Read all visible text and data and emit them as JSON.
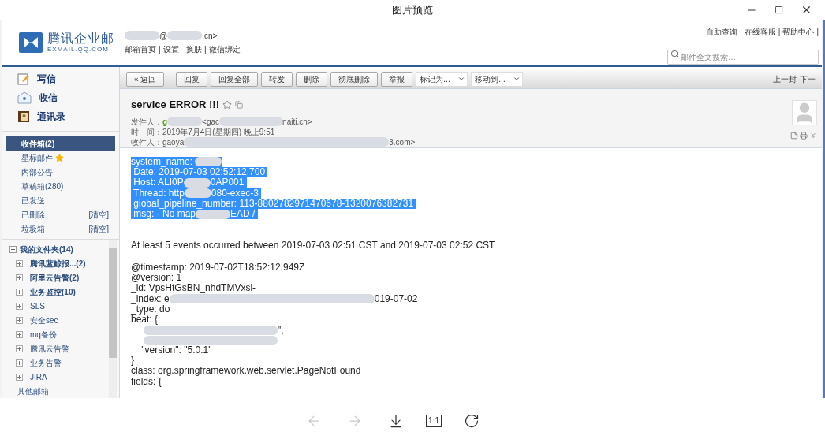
{
  "window": {
    "title": "图片预览"
  },
  "mail": {
    "logo": {
      "name": "腾讯企业邮",
      "domain": "EXMAIL.QQ.COM"
    },
    "account": [
      {
        "kind": "blot"
      },
      {
        "kind": "text",
        "text": "@"
      },
      {
        "kind": "blot"
      },
      {
        "kind": "text",
        "text": ".cn>"
      }
    ],
    "top_links": [
      {
        "label": "邮箱首页",
        "sep": "|"
      },
      {
        "label": "设置",
        "sep": "-"
      },
      {
        "label": "换肤",
        "sep": "|"
      },
      {
        "label": "微信绑定"
      }
    ],
    "help_links": [
      {
        "label": "自助查询",
        "sep": "|"
      },
      {
        "label": "在线客服",
        "sep": "|"
      },
      {
        "label": "帮助中心",
        "sep": "|"
      }
    ],
    "search": {
      "placeholder": "邮件全文搜索…"
    },
    "actions": [
      {
        "kind": "compose",
        "label": "写信"
      },
      {
        "kind": "receive",
        "label": "收信"
      },
      {
        "kind": "contacts",
        "label": "通讯录"
      }
    ],
    "folders": [
      {
        "label": "收件箱(2)",
        "selected": true
      },
      {
        "label": "星标邮件",
        "selected": false,
        "starred": true
      },
      {
        "label": "内部公告",
        "selected": false
      },
      {
        "label": "草稿箱(280)",
        "selected": false
      },
      {
        "label": "已发送",
        "selected": false
      },
      {
        "label": "已删除",
        "selected": false,
        "action": "[清空]"
      },
      {
        "label": "垃圾箱",
        "selected": false,
        "action": "[清空]"
      }
    ],
    "my_folders": {
      "label": "我的文件夹(14)",
      "expanded": true,
      "children": [
        {
          "label": "腾讯蓝鲸报...(2)",
          "unread": true
        },
        {
          "label": "阿里云告警(2)",
          "unread": true
        },
        {
          "label": "业务监控(10)",
          "unread": true
        },
        {
          "label": "SLS",
          "unread": false
        },
        {
          "label": "安全sec",
          "unread": false
        },
        {
          "label": "mq备份",
          "unread": false
        },
        {
          "label": "腾讯云告警",
          "unread": false
        },
        {
          "label": "业务告警",
          "unread": false
        },
        {
          "label": "JIRA",
          "unread": false
        }
      ]
    },
    "other_mailboxes": "其他邮箱",
    "toolbar": {
      "buttons": [
        "« 返回",
        "回复",
        "回复全部",
        "转发",
        "删除",
        "彻底删除",
        "举报"
      ],
      "selects": [
        "标记为...",
        "移动到..."
      ],
      "nav": [
        "上一封",
        "下一"
      ]
    },
    "subject": "service ERROR !!!",
    "meta": [
      {
        "label": "发件人：",
        "parts": [
          {
            "kind": "text",
            "text": "g",
            "color": "#5a9e1a"
          },
          {
            "kind": "blot"
          },
          {
            "kind": "text",
            "text": "<gac"
          },
          {
            "kind": "smear"
          },
          {
            "kind": "text",
            "text": "naiti.cn>"
          }
        ]
      },
      {
        "label": "时　间：",
        "parts": [
          {
            "kind": "text",
            "text": "2019年7月4日(星期四) 晚上9:51"
          }
        ]
      },
      {
        "label": "收件人：",
        "parts": [
          {
            "kind": "text",
            "text": "gaoya"
          },
          {
            "kind": "band"
          },
          {
            "kind": "text",
            "text": "3.com>"
          }
        ]
      }
    ],
    "body": [
      {
        "selected": true,
        "lines": [
          [
            {
              "kind": "text",
              "text": "system_name: "
            },
            {
              "kind": "dab"
            }
          ],
          [
            {
              "kind": "text",
              "text": " Date: 2019-07-03 02:52:12,700 "
            }
          ],
          [
            {
              "kind": "text",
              "text": " Host: ALI0P"
            },
            {
              "kind": "dab"
            },
            {
              "kind": "text",
              "text": "0AP001 "
            }
          ],
          [
            {
              "kind": "text",
              "text": " Thread: http"
            },
            {
              "kind": "dab"
            },
            {
              "kind": "text",
              "text": "080-exec-3 "
            }
          ],
          [
            {
              "kind": "text",
              "text": " global_pipeline_number: 113-8802782971470678-1320076382731 "
            }
          ],
          [
            {
              "kind": "text",
              "text": " msg: - No map"
            },
            {
              "kind": "blot"
            },
            {
              "kind": "text",
              "text": "EAD / "
            }
          ]
        ]
      },
      {
        "selected": false,
        "lines": [
          [
            {
              "kind": "text",
              "text": "At least 5 events occurred between 2019-07-03 02:51 CST and 2019-07-03 02:52 CST"
            }
          ]
        ]
      },
      {
        "selected": false,
        "lines": [
          [
            {
              "kind": "text",
              "text": "@timestamp: 2019-07-02T18:52:12.949Z"
            }
          ],
          [
            {
              "kind": "text",
              "text": "@version: 1"
            }
          ],
          [
            {
              "kind": "text",
              "text": "_id: VpsHtGsBN_nhdTMVxsl-"
            }
          ],
          [
            {
              "kind": "text",
              "text": "_index: e"
            },
            {
              "kind": "band"
            },
            {
              "kind": "text",
              "text": "019-07-02"
            }
          ],
          [
            {
              "kind": "text",
              "text": "_type: do"
            }
          ],
          [
            {
              "kind": "text",
              "text": "beat: {"
            }
          ],
          [
            {
              "kind": "streak"
            },
            {
              "kind": "text",
              "text": "\","
            }
          ],
          [
            {
              "kind": "streak"
            }
          ],
          [
            {
              "kind": "text",
              "text": "    \"version\": \"5.0.1\""
            }
          ],
          [
            {
              "kind": "text",
              "text": "}"
            }
          ],
          [
            {
              "kind": "text",
              "text": "class: org.springframework.web.servlet.PageNotFound"
            }
          ],
          [
            {
              "kind": "text",
              "text": "fields: {"
            }
          ]
        ]
      }
    ]
  },
  "viewer_toolbar": [
    {
      "kind": "back",
      "disabled": true
    },
    {
      "kind": "forward",
      "disabled": true
    },
    {
      "kind": "download",
      "disabled": false
    },
    {
      "kind": "actual-size",
      "label": "1:1",
      "disabled": false
    },
    {
      "kind": "rotate",
      "disabled": false
    }
  ]
}
